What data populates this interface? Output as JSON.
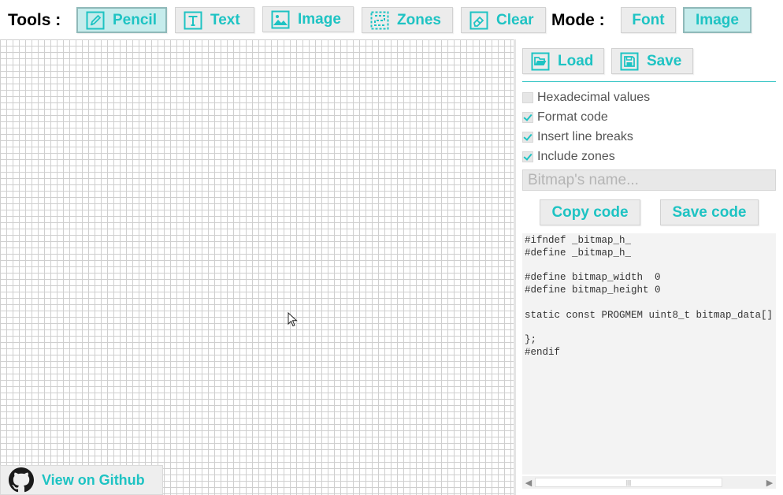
{
  "toolbar": {
    "tools_label": "Tools :",
    "mode_label": "Mode :",
    "tools": [
      {
        "label": "Pencil",
        "icon": "pencil-icon",
        "active": true
      },
      {
        "label": "Text",
        "icon": "text-icon",
        "active": false
      },
      {
        "label": "Image",
        "icon": "image-icon",
        "active": false
      },
      {
        "label": "Zones",
        "icon": "zones-icon",
        "active": false
      },
      {
        "label": "Clear",
        "icon": "eraser-icon",
        "active": false
      }
    ],
    "modes": [
      {
        "label": "Font",
        "active": false
      },
      {
        "label": "Image",
        "active": true
      }
    ]
  },
  "panel": {
    "load_label": "Load",
    "save_label": "Save",
    "options": [
      {
        "label": "Hexadecimal values",
        "checked": false
      },
      {
        "label": "Format code",
        "checked": true
      },
      {
        "label": "Insert line breaks",
        "checked": true
      },
      {
        "label": "Include zones",
        "checked": true
      }
    ],
    "name_placeholder": "Bitmap's name...",
    "copy_code_label": "Copy code",
    "save_code_label": "Save code",
    "code": "#ifndef _bitmap_h_\n#define _bitmap_h_\n\n#define bitmap_width  0\n#define bitmap_height 0\n\nstatic const PROGMEM uint8_t bitmap_data[] = {\n\n};\n#endif"
  },
  "footer": {
    "github_label": "View on Github"
  },
  "colors": {
    "accent": "#1ec3c3",
    "active_bg": "#c6ecec",
    "button_bg": "#ececec",
    "grid_line": "#cfcfcf"
  }
}
